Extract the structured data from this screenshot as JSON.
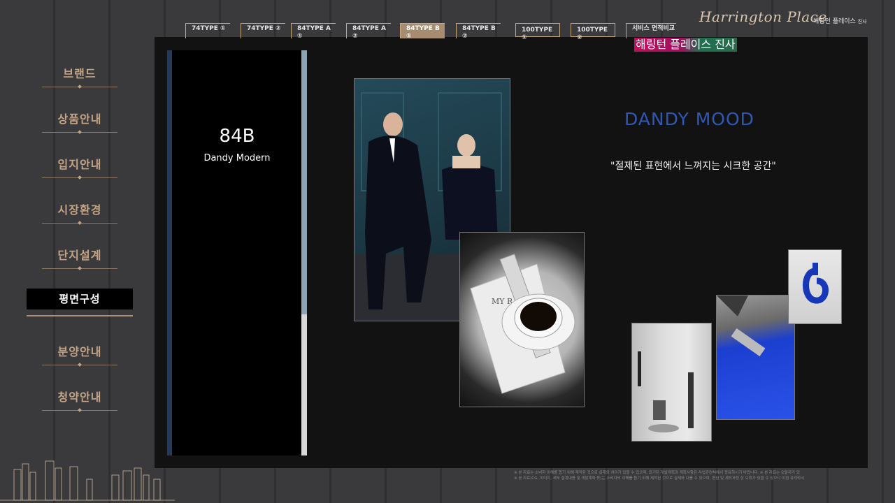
{
  "brand": {
    "script_logo": "Harrington Place",
    "kr_name": "해링턴 플레이스",
    "kr_suffix": "진사",
    "overlay_title": "해링턴 플레이스 진사"
  },
  "sidebar": {
    "items": [
      {
        "label": "브랜드",
        "active": false
      },
      {
        "label": "상품안내",
        "active": false
      },
      {
        "label": "입지안내",
        "active": false
      },
      {
        "label": "시장환경",
        "active": false
      },
      {
        "label": "단지설계",
        "active": false
      },
      {
        "label": "평면구성",
        "active": true
      },
      {
        "label": "분양안내",
        "active": false
      },
      {
        "label": "청약안내",
        "active": false
      }
    ]
  },
  "tabs": [
    {
      "label": "74TYPE ①",
      "active": false
    },
    {
      "label": "74TYPE ②",
      "active": false
    },
    {
      "label": "84TYPE A ①",
      "active": false
    },
    {
      "label": "84TYPE A ②",
      "active": false
    },
    {
      "label": "84TYPE B ①",
      "active": true
    },
    {
      "label": "84TYPE B ②",
      "active": false
    },
    {
      "label": "100TYPE ①",
      "active": false
    },
    {
      "label": "100TYPE ②",
      "active": false
    },
    {
      "label": "서비스 면적비교",
      "active": false
    }
  ],
  "type_card": {
    "code": "84B",
    "subtitle": "Dandy Modern"
  },
  "mood": {
    "title": "DANDY MOOD",
    "quote": "\"절제된 표현에서 느껴지는 시크한 공간\""
  },
  "photos": {
    "magazine_text": "MY R"
  },
  "disclaimer": {
    "line1": "※ 본 자료는 소비자 이해를 돕기 위해 제작된 것으로 실제와 차이가 있을 수 있으며, 표기된 개발계획과 계획사항은 사업관련처에서 종료하시기 바랍니다.  ※ 본 자료는 오탈자가 있",
    "line2": "※ 본 자료(CG, 이미지, 세부 설계내용 및 개발계획 등)는 소비자의 이해를 돕기 위해 제작된 것으로 실제와 다를 수 있으며, 편집 및 제작과정 상 오류가 있을 수 있으니 이점 유의하시"
  },
  "colors": {
    "accent_gold": "#c3a486",
    "mood_blue": "#2f58b4",
    "active_tab": "#a68c70"
  }
}
